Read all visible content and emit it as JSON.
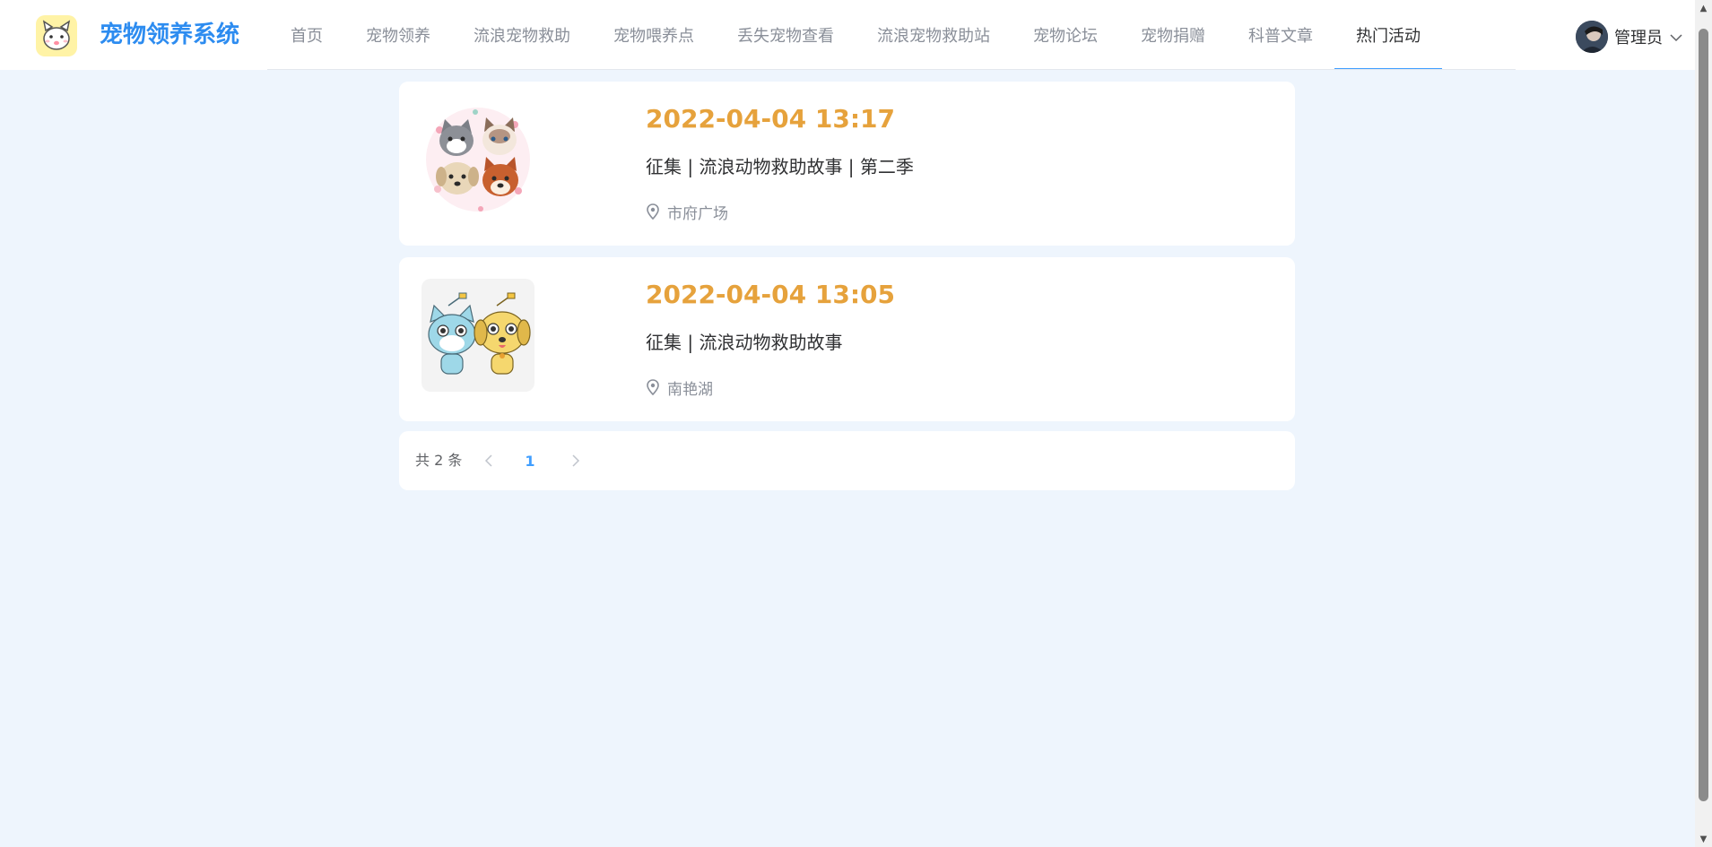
{
  "app": {
    "title": "宠物领养系统",
    "logo_icon": "cartoon-pet-logo-icon",
    "brand_color": "#2d8cf0"
  },
  "nav": {
    "items": [
      {
        "label": "首页",
        "active": false
      },
      {
        "label": "宠物领养",
        "active": false
      },
      {
        "label": "流浪宠物救助",
        "active": false
      },
      {
        "label": "宠物喂养点",
        "active": false
      },
      {
        "label": "丢失宠物查看",
        "active": false
      },
      {
        "label": "流浪宠物救助站",
        "active": false
      },
      {
        "label": "宠物论坛",
        "active": false
      },
      {
        "label": "宠物捐赠",
        "active": false
      },
      {
        "label": "科普文章",
        "active": false
      },
      {
        "label": "热门活动",
        "active": true
      }
    ],
    "active_color": "#409eff"
  },
  "user": {
    "name": "管理员",
    "avatar_icon": "user-avatar-icon",
    "menu_icon": "chevron-down-icon"
  },
  "activities": [
    {
      "image_icon": "cats-and-dogs-illustration",
      "date": "2022-04-04 13:17",
      "title": "征集 | 流浪动物救助故事 | 第二季",
      "location": "市府广场",
      "location_icon": "location-pin-icon"
    },
    {
      "image_icon": "cartoon-cat-and-dog-illustration",
      "date": "2022-04-04 13:05",
      "title": "征集 | 流浪动物救助故事",
      "location": "南艳湖",
      "location_icon": "location-pin-icon"
    }
  ],
  "pagination": {
    "total_text": "共 2 条",
    "current_page": "1",
    "prev_icon": "chevron-left-icon",
    "next_icon": "chevron-right-icon"
  },
  "colors": {
    "page_background": "#eef5fd",
    "date_color": "#e6a23c"
  }
}
